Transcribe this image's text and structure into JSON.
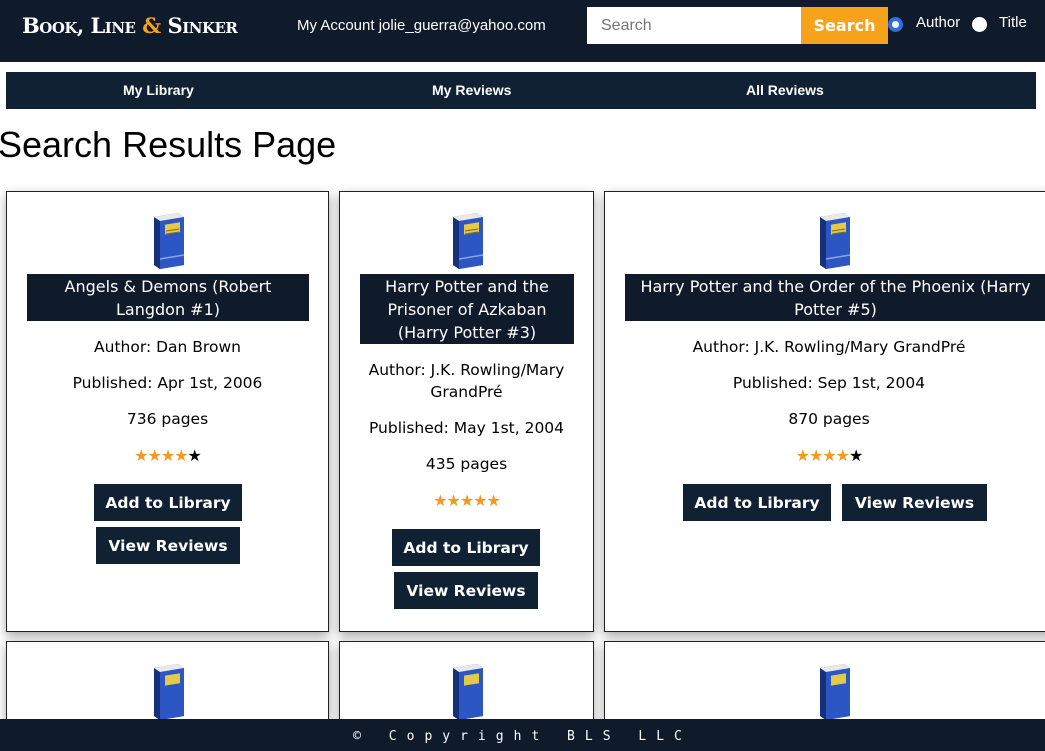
{
  "header": {
    "logo_text": "Book, Line & Sinker",
    "logo_part1": "Book, Line ",
    "logo_amp": "&",
    "logo_part2": " Sinker",
    "account_label": "My Account",
    "account_email": "jolie_guerra@yahoo.com",
    "search": {
      "placeholder": "Search",
      "value": "",
      "button_label": "Search"
    },
    "search_by": {
      "options": [
        "Author",
        "Title"
      ],
      "selected": "Author"
    }
  },
  "nav": {
    "items": [
      "My Library",
      "My Reviews",
      "All Reviews"
    ]
  },
  "page_title": "Search Results Page",
  "colors": {
    "header_bg": "#0f1a2b",
    "accent": "#f7a21b",
    "star": "#f29a1e",
    "button_bg": "#102133"
  },
  "books": [
    {
      "title": "Angels & Demons (Robert Langdon #1)",
      "author": "Author: Dan Brown",
      "published": "Published: Apr 1st, 2006",
      "pages": "736 pages",
      "rating": 4,
      "rating_max": 5,
      "add_label": "Add to Library",
      "reviews_label": "View Reviews"
    },
    {
      "title": "Harry Potter and the Prisoner of Azkaban (Harry Potter #3)",
      "author": "Author: J.K. Rowling/Mary GrandPré",
      "published": "Published: May 1st, 2004",
      "pages": "435 pages",
      "rating": 5,
      "rating_max": 5,
      "add_label": "Add to Library",
      "reviews_label": "View Reviews"
    },
    {
      "title": "Harry Potter and the Order of the Phoenix (Harry Potter #5)",
      "author": "Author: J.K. Rowling/Mary GrandPré",
      "published": "Published: Sep 1st, 2004",
      "pages": "870 pages",
      "rating": 4,
      "rating_max": 5,
      "add_label": "Add to Library",
      "reviews_label": "View Reviews"
    }
  ],
  "icons": {
    "book": "blue-book-icon",
    "star": "star-icon"
  },
  "footer": {
    "text": "© Copyright BLS LLC"
  }
}
